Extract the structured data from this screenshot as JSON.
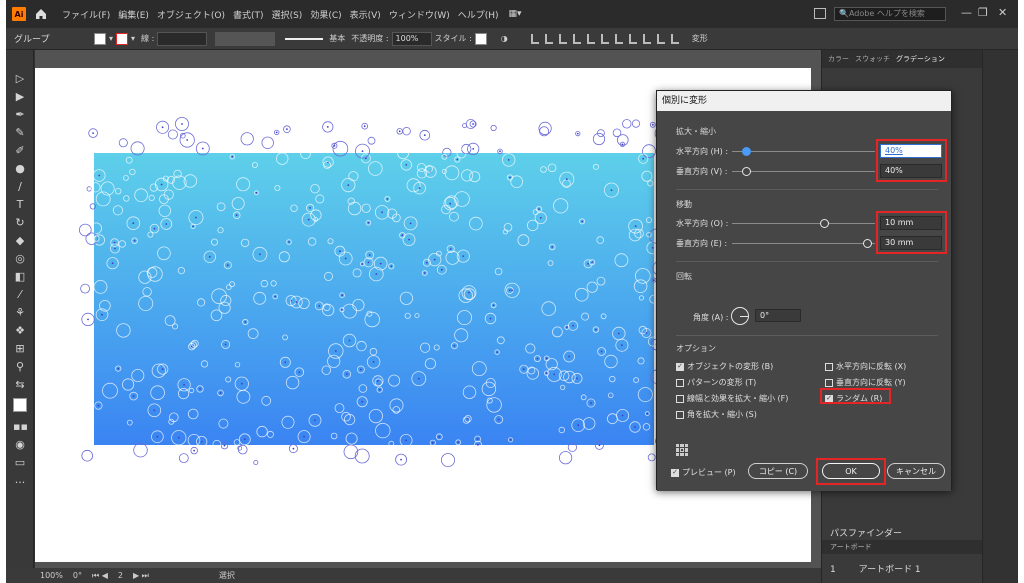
{
  "menubar": {
    "items": [
      "ファイル(F)",
      "編集(E)",
      "オブジェクト(O)",
      "書式(T)",
      "選択(S)",
      "効果(C)",
      "表示(V)",
      "ウィンドウ(W)",
      "ヘルプ(H)"
    ],
    "search_placeholder": "Adobe ヘルプを検索"
  },
  "control_bar": {
    "selection": "グループ",
    "stroke_label": "線 :",
    "stroke_style": "基本",
    "opacity_label": "不透明度 :",
    "opacity": "100%",
    "style_label": "スタイル :",
    "transform_label": "変形"
  },
  "dialog": {
    "title": "個別に変形",
    "scale": {
      "heading": "拡大・縮小",
      "horizontal_label": "水平方向 (H) :",
      "horizontal_value": "40%",
      "vertical_label": "垂直方向 (V) :",
      "vertical_value": "40%",
      "horizontal_level": 0.1,
      "vertical_level": 0.1
    },
    "move": {
      "heading": "移動",
      "horizontal_label": "水平方向 (O) :",
      "horizontal_value": "10 mm",
      "vertical_label": "垂直方向 (E) :",
      "vertical_value": "30 mm",
      "horizontal_level": 0.65,
      "vertical_level": 0.95
    },
    "rotate": {
      "heading": "回転",
      "angle_label": "角度 (A) :",
      "angle_value": "0°"
    },
    "options": {
      "heading": "オプション",
      "items": [
        {
          "label": "オブジェクトの変形 (B)",
          "checked": true
        },
        {
          "label": "水平方向に反転 (X)",
          "checked": false
        },
        {
          "label": "パターンの変形 (T)",
          "checked": false
        },
        {
          "label": "垂直方向に反転 (Y)",
          "checked": false
        },
        {
          "label": "線幅と効果を拡大・縮小 (F)",
          "checked": false
        },
        {
          "label": "ランダム (R)",
          "checked": true
        },
        {
          "label": "角を拡大・縮小 (S)",
          "checked": false
        }
      ]
    },
    "preview_label": "プレビュー (P)",
    "preview_checked": true,
    "copy_button": "コピー (C)",
    "ok_button": "OK",
    "cancel_button": "キャンセル"
  },
  "right_panel": {
    "tabs": [
      "カラー",
      "スウォッチ",
      "グラデーション"
    ],
    "pathfinder_label": "パスファインダー",
    "artboards_label": "アートボード",
    "artboard_index": "1",
    "artboard_name": "アートボード 1"
  },
  "status_bar": {
    "zoom": "100%",
    "rotation": "0°",
    "artboard_number": "2",
    "mode": "選択"
  },
  "colors": {
    "gradient_top": "#5ed0ea",
    "gradient_bottom": "#3a84f2",
    "highlight": "#e42525",
    "slider_blue": "#4a9af6"
  }
}
